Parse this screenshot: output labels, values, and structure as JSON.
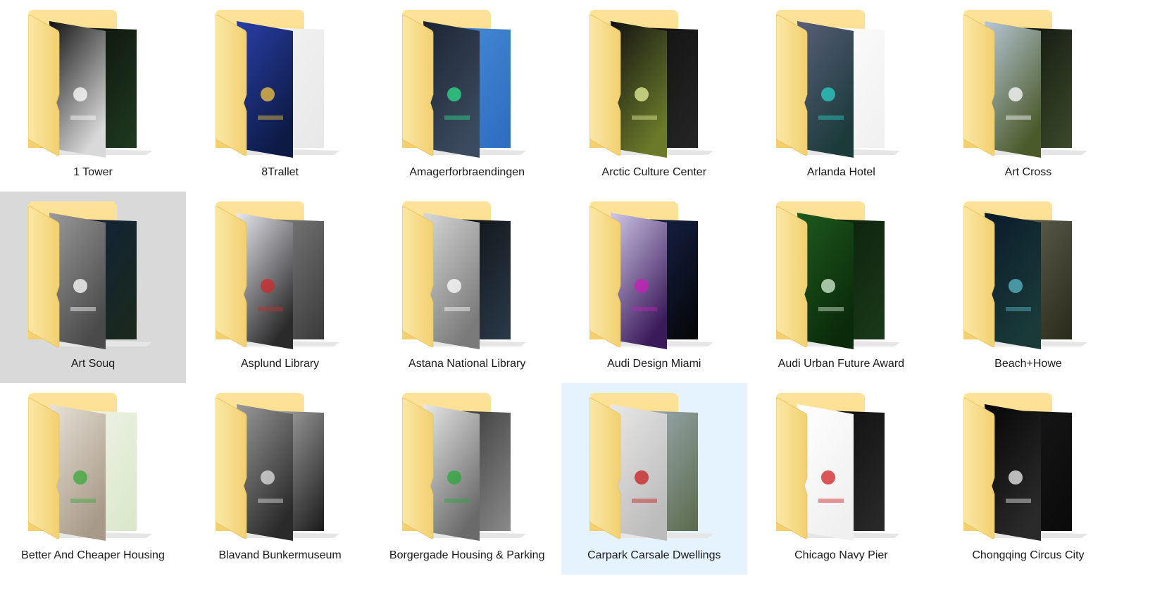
{
  "folders": [
    {
      "label": "1 Tower",
      "state": "normal",
      "thumbs": {
        "back": [
          "#0a0a0a",
          "#1f3a1f"
        ],
        "front": [
          "#111111",
          "#d9d9d9"
        ],
        "accent": "#ffffff"
      }
    },
    {
      "label": "8Trallet",
      "state": "normal",
      "thumbs": {
        "back": [
          "#f4f4f4",
          "#e8e8e8"
        ],
        "front": [
          "#2a3fa8",
          "#0c1a44"
        ],
        "accent": "#f5c542"
      }
    },
    {
      "label": "Amagerforbraendingen",
      "state": "normal",
      "thumbs": {
        "back": [
          "#4a8fd8",
          "#2d6cc0"
        ],
        "front": [
          "#1c2433",
          "#3b4a5e"
        ],
        "accent": "#2ee08a"
      }
    },
    {
      "label": "Arctic Culture Center",
      "state": "normal",
      "thumbs": {
        "back": [
          "#0d0d0d",
          "#262626"
        ],
        "front": [
          "#111111",
          "#6b7a2a"
        ],
        "accent": "#e8f29a"
      }
    },
    {
      "label": "Arlanda Hotel",
      "state": "normal",
      "thumbs": {
        "back": [
          "#ffffff",
          "#f0f0f0"
        ],
        "front": [
          "#5a5f7a",
          "#1b3a3a"
        ],
        "accent": "#2ad0c8"
      }
    },
    {
      "label": "Art Cross",
      "state": "normal",
      "thumbs": {
        "back": [
          "#0a0a0a",
          "#3a4a2a"
        ],
        "front": [
          "#b8c8d8",
          "#4a5a2a"
        ],
        "accent": "#ffffff"
      }
    },
    {
      "label": "Art Souq",
      "state": "selected",
      "thumbs": {
        "back": [
          "#102040",
          "#1a2a1a"
        ],
        "front": [
          "#9a9a9a",
          "#4a4a4a"
        ],
        "accent": "#ffffff"
      }
    },
    {
      "label": "Asplund Library",
      "state": "normal",
      "thumbs": {
        "back": [
          "#8a8a8a",
          "#3a3a3a"
        ],
        "front": [
          "#e8e8f0",
          "#2a2a2a"
        ],
        "accent": "#cc2a2a"
      }
    },
    {
      "label": "Astana National Library",
      "state": "normal",
      "thumbs": {
        "back": [
          "#0a0a0a",
          "#2a3a4a"
        ],
        "front": [
          "#d8d8d8",
          "#7a7a7a"
        ],
        "accent": "#ffffff"
      }
    },
    {
      "label": "Audi Design Miami",
      "state": "normal",
      "thumbs": {
        "back": [
          "#1a2a5a",
          "#050505"
        ],
        "front": [
          "#d0c8e8",
          "#3a1a5a"
        ],
        "accent": "#c81eb8"
      }
    },
    {
      "label": "Audi Urban Future Award",
      "state": "normal",
      "thumbs": {
        "back": [
          "#0a1a0a",
          "#1a3a1a"
        ],
        "front": [
          "#1e5a1e",
          "#0a2a0a"
        ],
        "accent": "#d8f0d8"
      }
    },
    {
      "label": "Beach+Howe",
      "state": "normal",
      "thumbs": {
        "back": [
          "#6a6a5a",
          "#2a2a1a"
        ],
        "front": [
          "#0a1a2a",
          "#1a3a3a"
        ],
        "accent": "#5ab8c8"
      }
    },
    {
      "label": "Better And Cheaper Housing",
      "state": "normal",
      "thumbs": {
        "back": [
          "#f4f4ee",
          "#d8e8c8"
        ],
        "front": [
          "#e8e2d8",
          "#a89a88"
        ],
        "accent": "#3aa83a"
      }
    },
    {
      "label": "Blavand Bunkermuseum",
      "state": "normal",
      "thumbs": {
        "back": [
          "#c8c8c8",
          "#1a1a1a"
        ],
        "front": [
          "#9a9a9a",
          "#2a2a2a"
        ],
        "accent": "#e0e0e0"
      }
    },
    {
      "label": "Borgergade  Housing & Parking",
      "state": "normal",
      "thumbs": {
        "back": [
          "#2a2a2a",
          "#8a8a8a"
        ],
        "front": [
          "#e8e8e8",
          "#6a6a6a"
        ],
        "accent": "#2aa83a"
      }
    },
    {
      "label": "Carpark Carsale Dwellings",
      "state": "hover",
      "thumbs": {
        "back": [
          "#a8b8c8",
          "#5a6a4a"
        ],
        "front": [
          "#e8e8e8",
          "#bcbcbc"
        ],
        "accent": "#c81e1e"
      }
    },
    {
      "label": "Chicago Navy Pier",
      "state": "normal",
      "thumbs": {
        "back": [
          "#0a0a0a",
          "#2a2a2a"
        ],
        "front": [
          "#ffffff",
          "#f0f0f0"
        ],
        "accent": "#d02020"
      }
    },
    {
      "label": "Chongqing Circus City",
      "state": "normal",
      "thumbs": {
        "back": [
          "#1a1a1a",
          "#0a0a0a"
        ],
        "front": [
          "#050505",
          "#2a2a2a"
        ],
        "accent": "#f0f0f0"
      }
    }
  ]
}
